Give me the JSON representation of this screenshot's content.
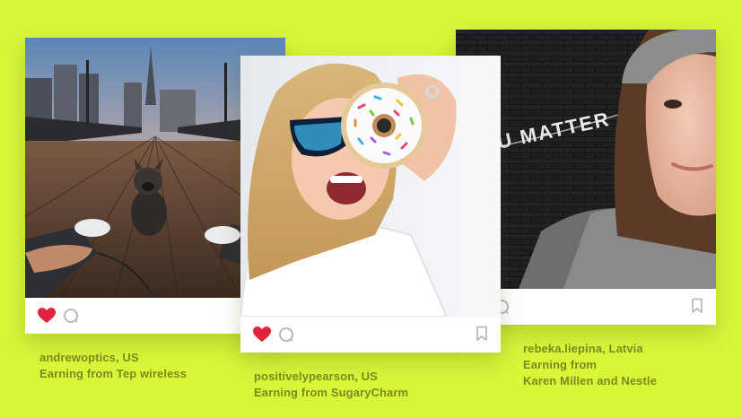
{
  "colors": {
    "background": "#d9f53a",
    "caption_text": "#7d8a1a",
    "like_red": "#e0243b",
    "icon_gray": "#b3b3b3"
  },
  "posts": [
    {
      "photo_subject": "first-person view of legs with a french bulldog on a wooden pier, city skyline at sunset",
      "liked": true,
      "icons": [
        "heart-icon",
        "comment-icon"
      ],
      "caption_lines": [
        "andrewoptics, US",
        "Earning from Tep wireless"
      ]
    },
    {
      "photo_subject": "smiling blonde woman in sunglasses holding a sprinkled donut over her eye",
      "liked": true,
      "icons": [
        "heart-icon",
        "comment-icon",
        "bookmark-icon"
      ],
      "caption_lines": [
        "positivelypearson, US",
        "Earning from SugaryCharm"
      ]
    },
    {
      "photo_subject": "woman in grey knit hat in front of a black brick wall with a letter banner",
      "photo_text": "U MATTER",
      "liked": false,
      "icons": [
        "comment-icon",
        "bookmark-icon"
      ],
      "caption_lines": [
        "rebeka.liepina, Latvia",
        "Earning from",
        "Karen Millen and Nestle"
      ]
    }
  ]
}
